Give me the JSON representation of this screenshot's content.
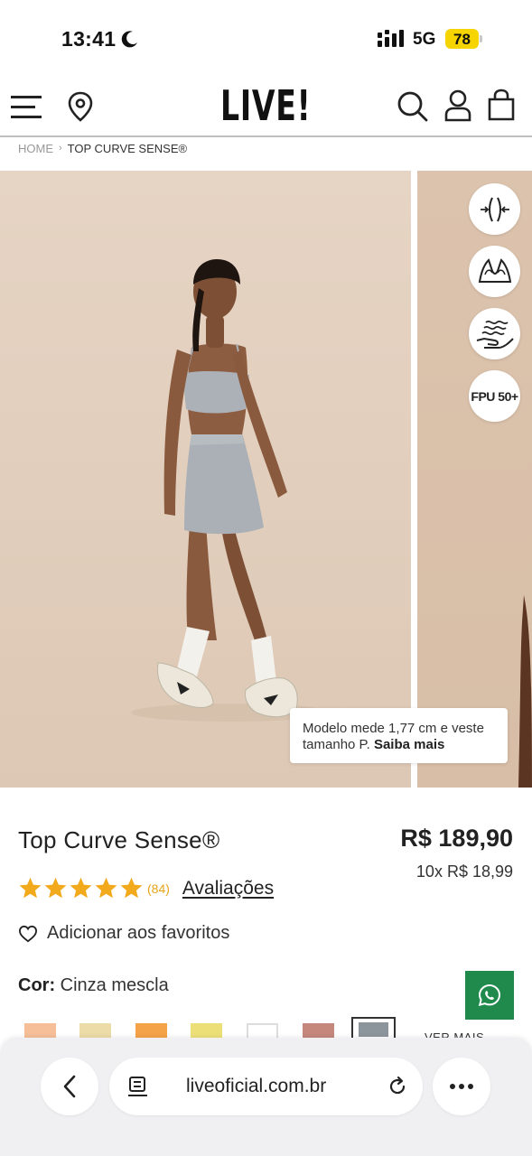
{
  "status_bar": {
    "time": "13:41",
    "network": "5G",
    "battery": "78"
  },
  "header": {
    "logo": "LIVE!"
  },
  "breadcrumb": {
    "home": "HOME",
    "separator": "›",
    "current": "TOP CURVE SENSE®"
  },
  "gallery": {
    "features": [
      {
        "icon": "compression-icon"
      },
      {
        "icon": "bra-support-icon"
      },
      {
        "icon": "hand-breathable-icon"
      },
      {
        "icon": "uv-protection-icon",
        "label": "FPU 50+"
      }
    ],
    "model_note": {
      "text": "Modelo mede 1,77 cm e veste tamanho P.",
      "link": "Saiba mais"
    }
  },
  "product": {
    "title": "Top Curve Sense®",
    "price": "R$ 189,90",
    "installments": "10x R$ 18,99",
    "rating": {
      "stars": 5,
      "count": "(84)",
      "link": "Avaliações"
    },
    "favorite_label": "Adicionar aos favoritos",
    "color_label": "Cor:",
    "color_value": "Cinza mescla",
    "see_more": "VER MAIS",
    "swatches": [
      "#f6bf98",
      "#ecdca7",
      "#f5a348",
      "#eddf78",
      "#ffffff",
      "#c4877c",
      "#8c949c"
    ]
  },
  "browser": {
    "url": "liveoficial.com.br"
  },
  "colors": {
    "star": "#f2a91c",
    "whatsapp": "#1f8a4c",
    "battery": "#f5d400"
  }
}
